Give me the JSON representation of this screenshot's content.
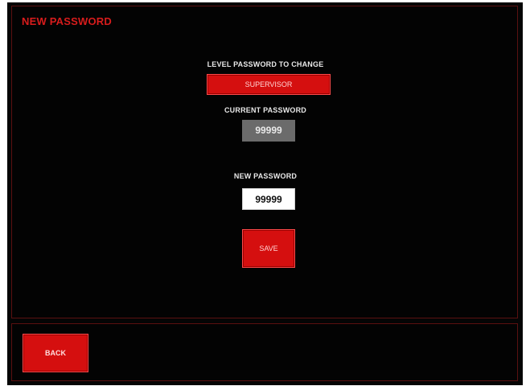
{
  "header": {
    "title": "NEW PASSWORD"
  },
  "form": {
    "level_label": "LEVEL PASSWORD TO CHANGE",
    "level_value": "SUPERVISOR",
    "current_label": "CURRENT PASSWORD",
    "current_value": "99999",
    "new_label": "NEW PASSWORD",
    "new_value": "99999",
    "save_label": "SAVE"
  },
  "footer": {
    "back_label": "BACK"
  },
  "colors": {
    "accent": "#d50f0f",
    "background": "#050505",
    "panel_border": "#5a1010"
  }
}
